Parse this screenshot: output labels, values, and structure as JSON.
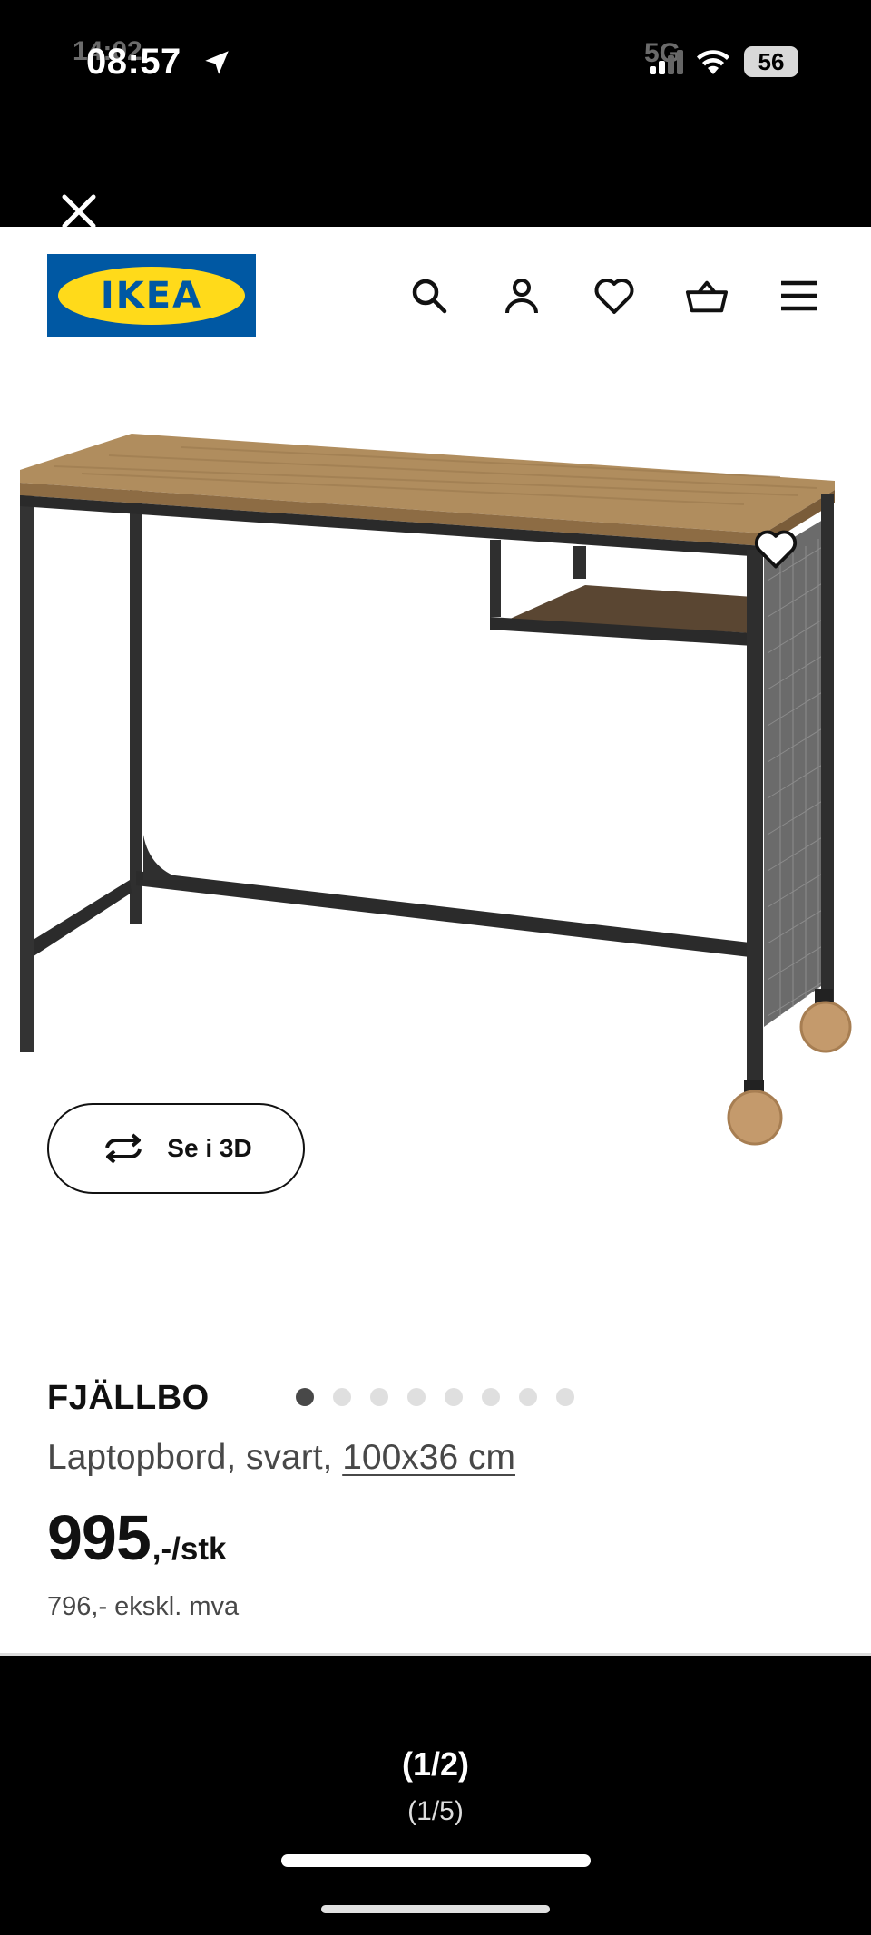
{
  "status_bar": {
    "time": "08:57",
    "ghost_time": "14:02",
    "ghost_network": "5G",
    "battery": "56"
  },
  "overlay": {
    "close_icon": "close-icon"
  },
  "header": {
    "logo_text": "IKEA",
    "icons": [
      "search-icon",
      "user-icon",
      "heart-icon",
      "basket-icon",
      "menu-icon"
    ]
  },
  "gallery": {
    "view_3d_label": "Se i 3D",
    "total_images": 8,
    "active_index": 0
  },
  "product": {
    "name": "FJÄLLBO",
    "description": "Laptopbord, svart, ",
    "size": "100x36 cm",
    "price": "995",
    "price_suffix": ",-/stk",
    "price_ex_vat": "796,- ekskl. mva"
  },
  "viewer": {
    "counter_main": "(1/2)",
    "counter_sub": "(1/5)"
  },
  "colors": {
    "ikea_blue": "#0058a3",
    "ikea_yellow": "#ffda1a",
    "wood": "#b08d5e",
    "frame": "#2f2f2f"
  }
}
